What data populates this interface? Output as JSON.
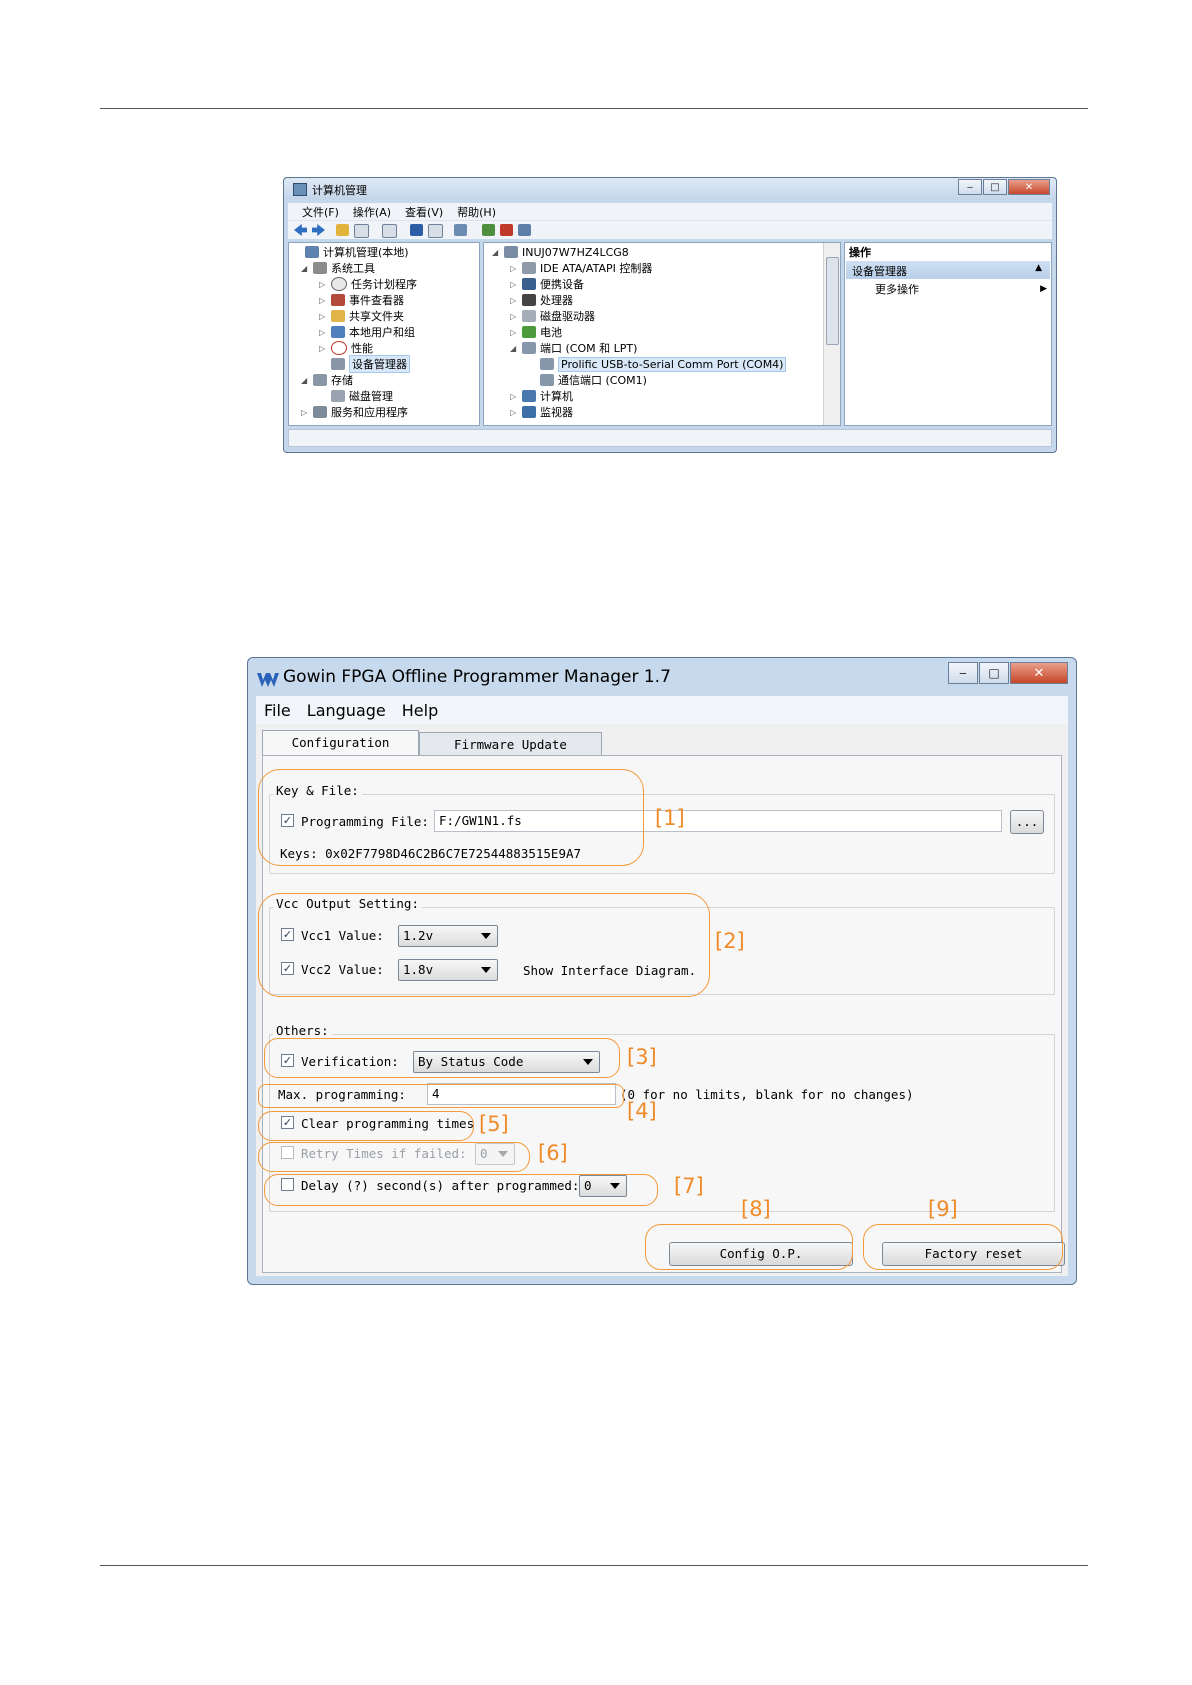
{
  "computer_management": {
    "title": "计算机管理",
    "menu": [
      "文件(F)",
      "操作(A)",
      "查看(V)",
      "帮助(H)"
    ],
    "tree": [
      {
        "label": "计算机管理(本地)",
        "arrow": ""
      },
      {
        "label": "系统工具",
        "arrow": "◢"
      },
      {
        "label": "任务计划程序",
        "arrow": "▷"
      },
      {
        "label": "事件查看器",
        "arrow": "▷"
      },
      {
        "label": "共享文件夹",
        "arrow": "▷"
      },
      {
        "label": "本地用户和组",
        "arrow": "▷"
      },
      {
        "label": "性能",
        "arrow": "▷"
      },
      {
        "label": "设备管理器",
        "arrow": "",
        "selected": true
      },
      {
        "label": "存储",
        "arrow": "◢"
      },
      {
        "label": "磁盘管理",
        "arrow": ""
      },
      {
        "label": "服务和应用程序",
        "arrow": "▷"
      }
    ],
    "devices": [
      {
        "label": "INUJ07W7HZ4LCG8",
        "arrow": "◢"
      },
      {
        "label": "IDE ATA/ATAPI 控制器",
        "arrow": "▷"
      },
      {
        "label": "便携设备",
        "arrow": "▷"
      },
      {
        "label": "处理器",
        "arrow": "▷"
      },
      {
        "label": "磁盘驱动器",
        "arrow": "▷"
      },
      {
        "label": "电池",
        "arrow": "▷"
      },
      {
        "label": "端口 (COM 和 LPT)",
        "arrow": "◢"
      },
      {
        "label": "Prolific USB-to-Serial Comm Port (COM4)",
        "arrow": "",
        "selected": true
      },
      {
        "label": "通信端口 (COM1)",
        "arrow": ""
      },
      {
        "label": "计算机",
        "arrow": "▷"
      },
      {
        "label": "监视器",
        "arrow": "▷"
      }
    ],
    "actions": {
      "header": "操作",
      "section": "设备管理器",
      "more": "更多操作"
    }
  },
  "gowin": {
    "title": "Gowin FPGA Offline Programmer Manager 1.7",
    "menu": [
      "File",
      "Language",
      "Help"
    ],
    "tabs": [
      "Configuration",
      "Firmware Update"
    ],
    "key_file": {
      "group": "Key & File:",
      "programming_file_label": "Programming File:",
      "programming_file_value": "F:/GW1N1.fs",
      "browse_label": "...",
      "keys": "Keys: 0x02F7798D46C2B6C7E72544883515E9A7"
    },
    "vcc": {
      "group": "Vcc Output Setting:",
      "vcc1_label": "Vcc1 Value:",
      "vcc1_value": "1.2v",
      "vcc2_label": "Vcc2 Value:",
      "vcc2_value": "1.8v",
      "diagram_link": "Show Interface Diagram."
    },
    "others": {
      "group": "Others:",
      "verification_label": "Verification:",
      "verification_value": "By Status Code",
      "max_label": "Max. programming:",
      "max_value": "4",
      "max_hint": "(0 for no limits, blank for no changes)",
      "clear_label": "Clear programming times",
      "retry_label": "Retry Times if failed:",
      "retry_value": "0",
      "delay_label": "Delay (?) second(s) after programmed:",
      "delay_value": "0"
    },
    "buttons": {
      "config": "Config O.P.",
      "factory": "Factory reset"
    },
    "annotations": [
      "[1]",
      "[2]",
      "[3]",
      "[4]",
      "[5]",
      "[6]",
      "[7]",
      "[8]",
      "[9]"
    ]
  }
}
